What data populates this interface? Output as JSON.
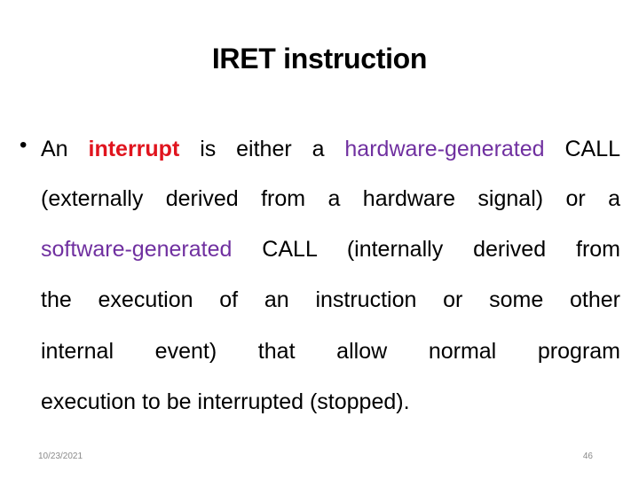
{
  "slide": {
    "title": "IRET instruction",
    "bullet_glyph": "•",
    "lines": [
      {
        "segments": [
          {
            "text": "An ",
            "style": "normal"
          },
          {
            "text": "interrupt",
            "style": "red"
          },
          {
            "text": " is either a ",
            "style": "normal"
          },
          {
            "text": "hardware-generated",
            "style": "purple"
          },
          {
            "text": " CALL",
            "style": "normal"
          }
        ]
      },
      {
        "segments": [
          {
            "text": "(externally derived from a hardware signal) or a",
            "style": "normal"
          }
        ]
      },
      {
        "segments": [
          {
            "text": "software-generated",
            "style": "purple"
          },
          {
            "text": " CALL (internally derived from",
            "style": "normal"
          }
        ]
      },
      {
        "segments": [
          {
            "text": "the execution of an instruction or some other",
            "style": "normal"
          }
        ]
      },
      {
        "segments": [
          {
            "text": "internal event) that allow normal program",
            "style": "normal"
          }
        ]
      },
      {
        "segments": [
          {
            "text": "execution to be interrupted (stopped).",
            "style": "normal"
          }
        ]
      }
    ],
    "footer": {
      "date": "10/23/2021",
      "page": "46"
    },
    "colors": {
      "emphasis_red": "#e0141e",
      "emphasis_purple": "#7030a0"
    }
  }
}
